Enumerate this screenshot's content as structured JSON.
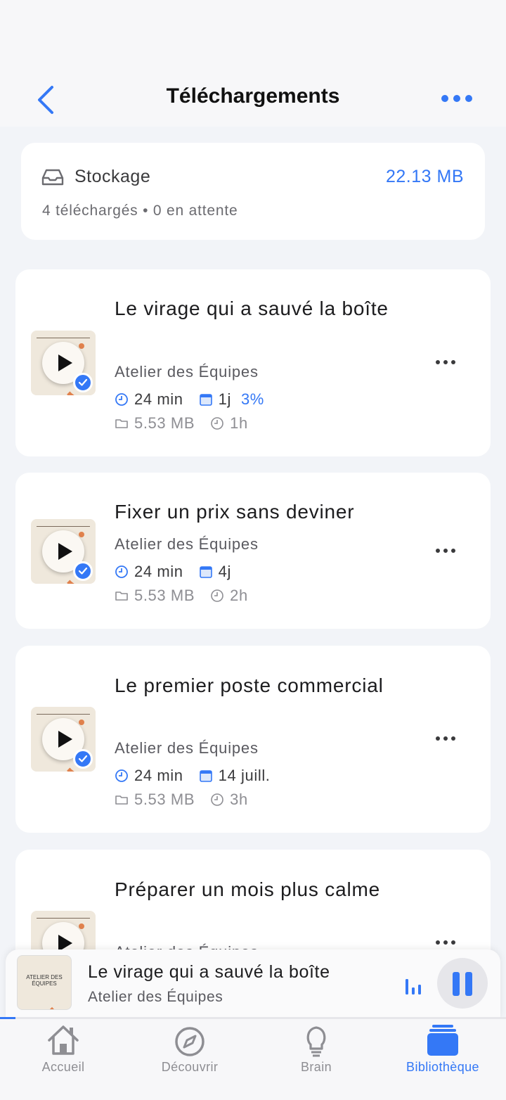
{
  "nav": {
    "title": "Téléchargements"
  },
  "storage": {
    "label": "Stockage",
    "total": "22.13 MB",
    "summary": "4 téléchargés • 0 en attente"
  },
  "episodes": [
    {
      "title": "Le virage qui a sauvé la boîte",
      "podcast": "Atelier des Équipes",
      "duration": "24 min",
      "age": "1j",
      "progress": "3%",
      "size": "5.53 MB",
      "downloaded_ago": "1h"
    },
    {
      "title": "Fixer un prix sans deviner",
      "podcast": "Atelier des Équipes",
      "duration": "24 min",
      "age": "4j",
      "size": "5.53 MB",
      "downloaded_ago": "2h"
    },
    {
      "title": "Le premier poste commercial",
      "podcast": "Atelier des Équipes",
      "duration": "24 min",
      "age": "14 juill.",
      "size": "5.53 MB",
      "downloaded_ago": "3h"
    },
    {
      "title": "Préparer un mois plus calme",
      "podcast": "Atelier des Équipes"
    }
  ],
  "mini_player": {
    "artwork_text": "ATELIER DES ÉQUIPES",
    "title": "Le virage qui a sauvé la boîte",
    "podcast": "Atelier des Équipes",
    "progress_fraction": 0.03
  },
  "tabs": [
    {
      "label": "Accueil",
      "icon": "home-icon"
    },
    {
      "label": "Découvrir",
      "icon": "compass-icon"
    },
    {
      "label": "Brain",
      "icon": "lightbulb-icon"
    },
    {
      "label": "Bibliothèque",
      "icon": "library-icon",
      "active": true
    }
  ],
  "colors": {
    "accent": "#3478f6",
    "background": "#f2f4f8",
    "artwork_orange": "#e0814c"
  }
}
